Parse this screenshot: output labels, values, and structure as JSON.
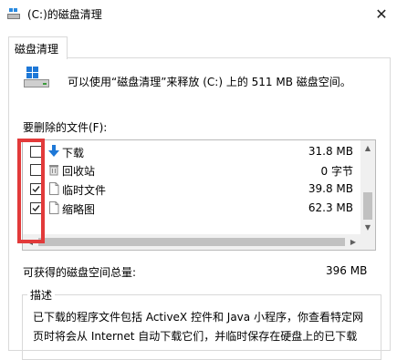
{
  "window": {
    "title": "(C:)的磁盘清理"
  },
  "tab": {
    "label": "磁盘清理"
  },
  "summary": {
    "text": "可以使用“磁盘清理”来释放  (C:) 上的 511 MB 磁盘空间。"
  },
  "files_label": "要删除的文件(F):",
  "files": [
    {
      "name": "下载",
      "size": "31.8 MB",
      "checked": false,
      "icon": "download-arrow-icon"
    },
    {
      "name": "回收站",
      "size": "0 字节",
      "checked": false,
      "icon": "recycle-bin-icon"
    },
    {
      "name": "临时文件",
      "size": "39.8 MB",
      "checked": true,
      "icon": "file-icon"
    },
    {
      "name": "缩略图",
      "size": "62.3 MB",
      "checked": true,
      "icon": "file-icon"
    }
  ],
  "gain": {
    "label": "可获得的磁盘空间总量:",
    "value": "396 MB"
  },
  "description": {
    "legend": "描述",
    "line1": "已下载的程序文件包括 ActiveX 控件和 Java 小程序，你查看特定网",
    "line2": "页时将会从 Internet 自动下载它们，并临时保存在硬盘上的已下载"
  },
  "colors": {
    "highlight": "#e23a3a",
    "accent_blue": "#1e78d7"
  }
}
